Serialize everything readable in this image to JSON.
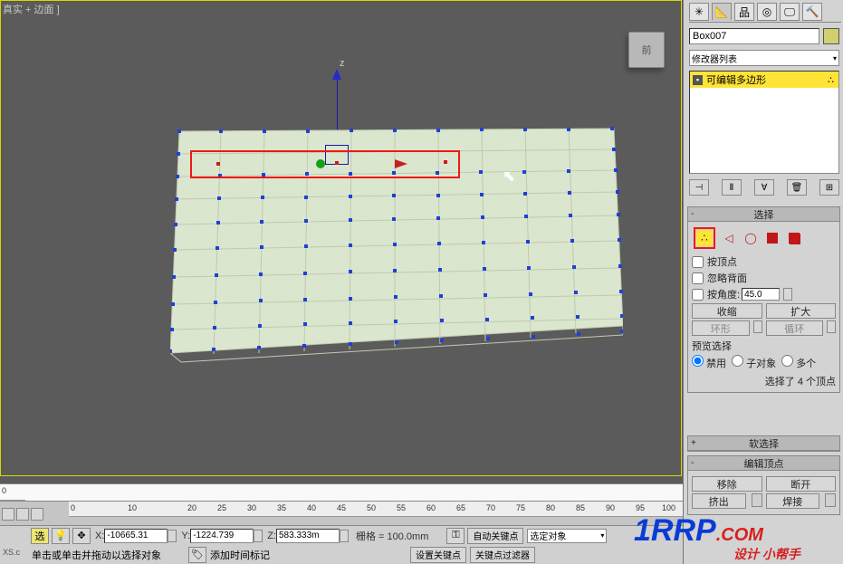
{
  "viewport": {
    "title": "真实 + 边面 ]",
    "view_label": "前",
    "axis_z": "z"
  },
  "timeline": {
    "ruler_stub": "100",
    "ruler_ticks": [
      "0",
      "10",
      "20",
      "25",
      "30",
      "35",
      "40",
      "45",
      "50",
      "55",
      "60",
      "65",
      "70",
      "75",
      "80",
      "85",
      "90",
      "95",
      "100"
    ]
  },
  "status": {
    "selection_label": "选",
    "x_label": "X:",
    "x_value": "-10665.31",
    "y_label": "Y:",
    "y_value": "-1224.739",
    "z_label": "Z:",
    "z_value": "583.333m",
    "grid_label": "栅格 = 100.0mm",
    "auto_key": "自动关键点",
    "set_key": "设置关键点",
    "selected_obj": "选定对象",
    "key_filter": "关键点过滤器",
    "hint": "单击或单击并拖动以选择对象",
    "add_time_tag": "添加时间标记",
    "xs": "XS.c"
  },
  "panel": {
    "object_name": "Box007",
    "modifier_list_label": "修改器列表",
    "modifier_item": "可编辑多边形"
  },
  "select_ro": {
    "title": "选择",
    "by_vertex": "按顶点",
    "ignore_back": "忽略背面",
    "by_angle": "按角度:",
    "angle_value": "45.0",
    "shrink": "收缩",
    "grow": "扩大",
    "ring": "环形",
    "loop": "循环",
    "preview_label": "预览选择",
    "radio_off": "禁用",
    "radio_subobj": "子对象",
    "radio_multi": "多个",
    "selected_info": "选择了 4 个顶点"
  },
  "soft_ro": {
    "title": "软选择"
  },
  "edit_ro": {
    "title": "编辑顶点",
    "remove": "移除",
    "break": "断开",
    "extrude": "挤出",
    "weld": "焊接"
  },
  "watermark": {
    "part1": "1RRP",
    "part2": ".COM",
    "part3": "设计 小帮手"
  }
}
